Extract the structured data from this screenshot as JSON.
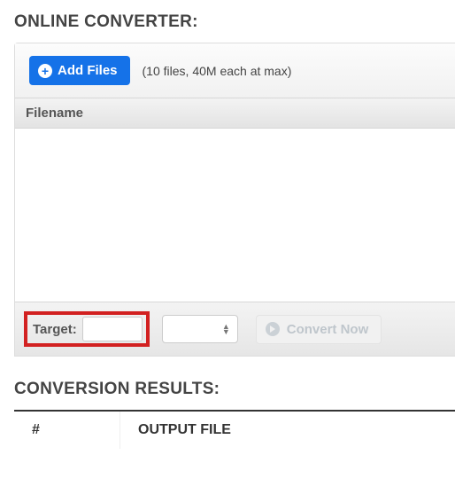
{
  "headings": {
    "online_converter": "ONLINE CONVERTER:",
    "conversion_results": "CONVERSION RESULTS:"
  },
  "toolbar": {
    "add_files_label": "Add Files",
    "hint": "(10 files, 40M each at max)"
  },
  "table": {
    "filename_header": "Filename"
  },
  "footer": {
    "target_label": "Target:",
    "target_value": "",
    "convert_label": "Convert Now"
  },
  "results_table": {
    "hash_header": "#",
    "output_header": "OUTPUT FILE"
  }
}
